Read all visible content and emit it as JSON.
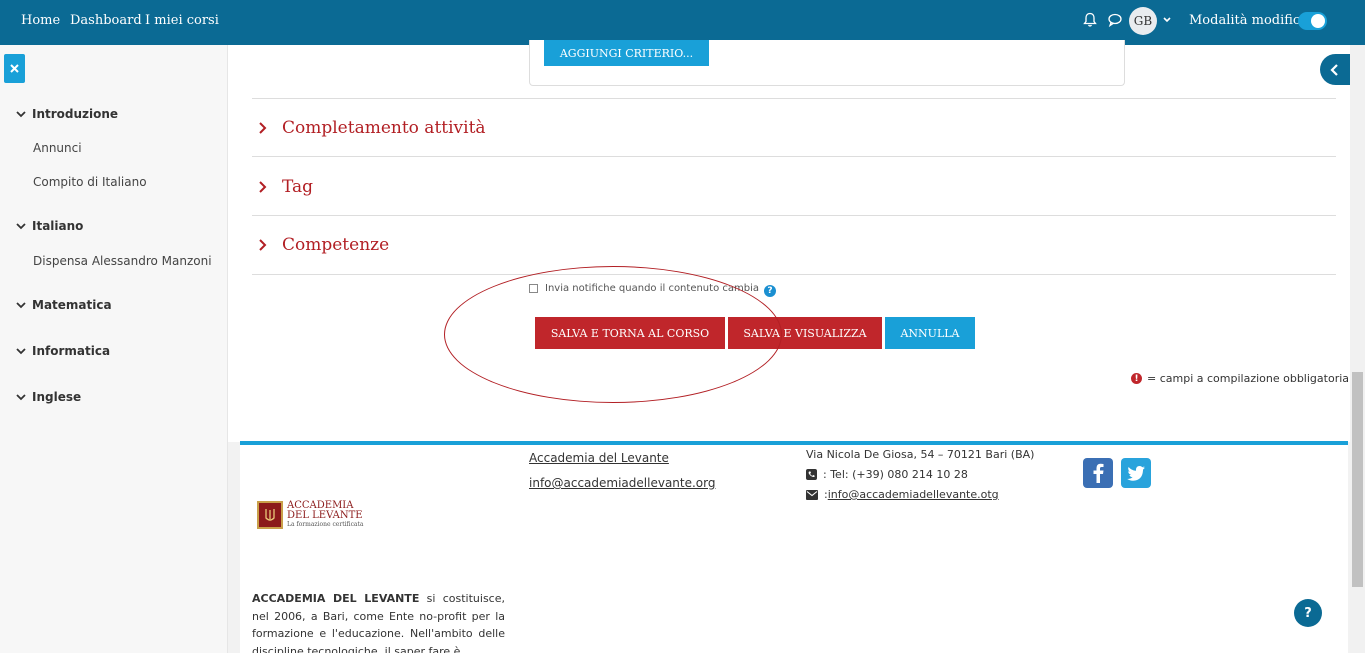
{
  "navbar": {
    "links": [
      "Home",
      "Dashboard",
      "I miei corsi"
    ],
    "avatar_initials": "GB",
    "edit_mode_label": "Modalità modifica",
    "edit_mode_on": true,
    "icons": [
      "bell-icon",
      "chat-icon",
      "chevron-down-icon"
    ]
  },
  "sidebar": {
    "sections": [
      {
        "title": "Introduzione",
        "items": [
          "Annunci",
          "Compito di Italiano"
        ]
      },
      {
        "title": "Italiano",
        "items": [
          "Dispensa Alessandro Manzoni"
        ]
      },
      {
        "title": "Matematica",
        "items": []
      },
      {
        "title": "Informatica",
        "items": []
      },
      {
        "title": "Inglese",
        "items": []
      }
    ]
  },
  "main": {
    "add_criterion_label": "AGGIUNGI CRITERIO...",
    "sections": [
      "Completamento attività",
      "Tag",
      "Competenze"
    ],
    "notify_label": "Invia notifiche quando il contenuto cambia",
    "notify_checked": false,
    "buttons": {
      "save_return": "SALVA E TORNA AL CORSO",
      "save_view": "SALVA E VISUALIZZA",
      "cancel": "ANNULLA"
    },
    "required_note": "= campi a compilazione obbligatoria"
  },
  "footer": {
    "logo_line1": "ACCADEMIA",
    "logo_line2": "DEL LEVANTE",
    "logo_tagline": "La formazione certificata",
    "about_bold": "ACCADEMIA DEL LEVANTE",
    "about_text": " si costituisce, nel 2006, a Bari, come Ente no-profit per la formazione e l'educazione. Nell'ambito delle discipline tecnologiche, il saper fare è",
    "link_site": "Accademia del Levante",
    "link_email": "info@accademiadellevante.org",
    "address": "Via Nicola De Giosa, 54 – 70121 Bari (BA)",
    "phone_label": ": Tel: (+39) 080 214 10 28",
    "email_prefix": ": ",
    "email_contact": "info@accademiadellevante.otg"
  },
  "colors": {
    "navbar": "#0b6a94",
    "accent_blue": "#19a0d8",
    "accent_red": "#c0262b",
    "heading_red": "#b21f24"
  }
}
